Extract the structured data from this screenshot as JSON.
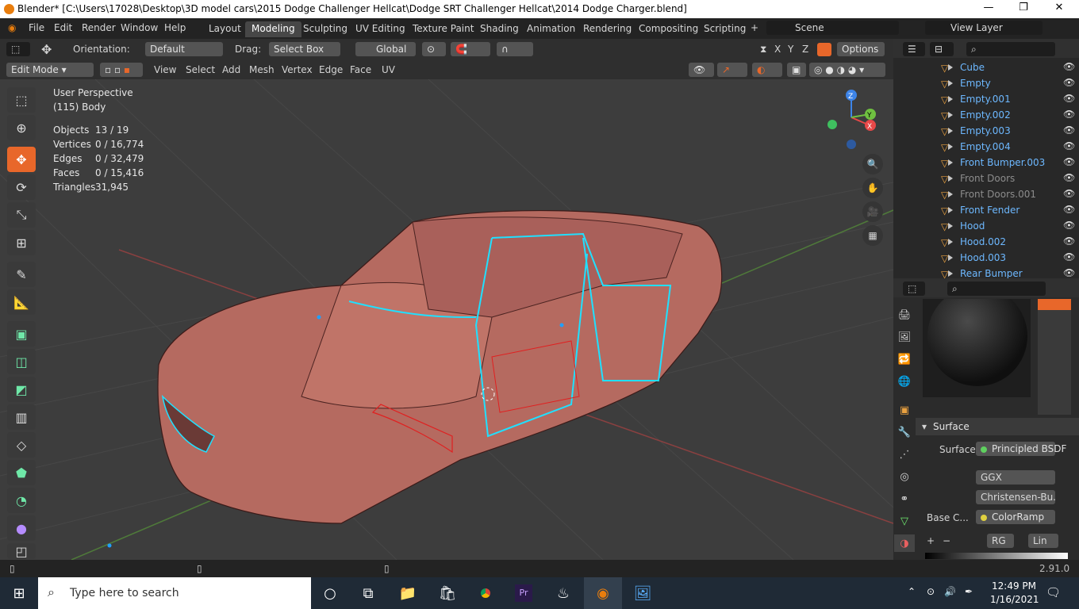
{
  "title": "Blender* [C:\\Users\\17028\\Desktop\\3D model cars\\2015 Dodge Challenger Hellcat\\Dodge SRT Challenger Hellcat\\2014 Dodge Charger.blend]",
  "menus": [
    "File",
    "Edit",
    "Render",
    "Window",
    "Help"
  ],
  "workspaces": [
    "Layout",
    "Modeling",
    "Sculpting",
    "UV Editing",
    "Texture Paint",
    "Shading",
    "Animation",
    "Rendering",
    "Compositing",
    "Scripting"
  ],
  "active_workspace": "Modeling",
  "scene": "Scene",
  "view_layer": "View Layer",
  "toolbar": {
    "orientation_label": "Orientation:",
    "orientation_value": "Default",
    "drag_label": "Drag:",
    "drag_value": "Select Box",
    "transform_value": "Global",
    "options": "Options"
  },
  "mode": "Edit Mode",
  "edit_menus": [
    "View",
    "Select",
    "Add",
    "Mesh",
    "Vertex",
    "Edge",
    "Face",
    "UV"
  ],
  "viewport": {
    "perspective": "User Perspective",
    "object": "(115) Body",
    "stats": [
      {
        "label": "Objects",
        "value": "13 / 19"
      },
      {
        "label": "Vertices",
        "value": "0 / 16,774"
      },
      {
        "label": "Edges",
        "value": "0 / 32,479"
      },
      {
        "label": "Faces",
        "value": "0 / 15,416"
      },
      {
        "label": "Triangles",
        "value": "31,945"
      }
    ],
    "gizmo": {
      "z": "Z",
      "y": "Y",
      "x": "X"
    }
  },
  "outliner": {
    "items": [
      {
        "name": "Cube",
        "color": "#6db8ff"
      },
      {
        "name": "Empty",
        "color": "#6db8ff"
      },
      {
        "name": "Empty.001",
        "color": "#6db8ff"
      },
      {
        "name": "Empty.002",
        "color": "#6db8ff"
      },
      {
        "name": "Empty.003",
        "color": "#6db8ff"
      },
      {
        "name": "Empty.004",
        "color": "#6db8ff"
      },
      {
        "name": "Front Bumper.003",
        "color": "#6db8ff"
      },
      {
        "name": "Front Doors",
        "color": "#8c8c8c"
      },
      {
        "name": "Front Doors.001",
        "color": "#8c8c8c"
      },
      {
        "name": "Front Fender",
        "color": "#6db8ff"
      },
      {
        "name": "Hood",
        "color": "#6db8ff"
      },
      {
        "name": "Hood.002",
        "color": "#6db8ff"
      },
      {
        "name": "Hood.003",
        "color": "#6db8ff"
      },
      {
        "name": "Rear Bumper",
        "color": "#6db8ff"
      }
    ]
  },
  "properties": {
    "section": "Surface",
    "surface_label": "Surface",
    "surface_value": "Principled BSDF",
    "distribution": "GGX",
    "subsurface": "Christensen-Bu...",
    "base_label": "Base C...",
    "base_value": "ColorRamp",
    "ramp_mode": "RG",
    "ramp_interp": "Lin"
  },
  "status": {
    "version": "2.91.0"
  },
  "taskbar": {
    "search_placeholder": "Type here to search",
    "time": "12:49 PM",
    "date": "1/16/2021"
  }
}
